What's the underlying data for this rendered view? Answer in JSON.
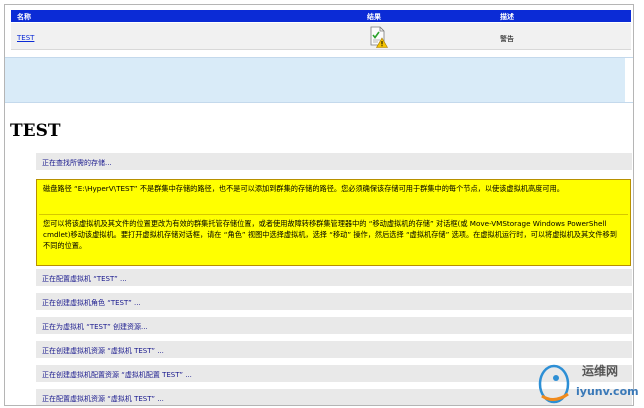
{
  "results_table": {
    "headers": {
      "name": "名称",
      "result": "结果",
      "description": "描述"
    },
    "row": {
      "name": "TEST",
      "result_icon": "warning-doc-icon",
      "description": "警告"
    }
  },
  "section_title": "TEST",
  "steps_before": [
    "正在查找所需的存储..."
  ],
  "warning": {
    "paragraph1": "磁盘路径 “E:\\HyperV\\TEST” 不是群集中存储的路径，也不是可以添加到群集的存储的路径。您必须确保该存储可用于群集中的每个节点，以使该虚拟机高度可用。",
    "paragraph2": "您可以将该虚拟机及其文件的位置更改为有效的群集托管存储位置，或者使用故障转移群集管理器中的 “移动虚拟机的存储” 对话框(或 Move-VMStorage Windows PowerShell cmdlet)移动该虚拟机。要打开虚拟机存储对话框，请在 “角色” 视图中选择虚拟机，选择 “移动” 操作，然后选择 “虚拟机存储” 选项。在虚拟机运行时，可以将虚拟机及其文件移到不同的位置。"
  },
  "steps_after": [
    "正在配置虚拟机 “TEST” ...",
    "正在创建虚拟机角色 “TEST” ...",
    "正在为虚拟机 “TEST” 创建资源...",
    "正在创建虚拟机资源 “虚拟机 TEST” ...",
    "正在创建虚拟机配置资源 “虚拟机配置 TEST” ...",
    "正在配置虚拟机资源 “虚拟机 TEST” ..."
  ],
  "watermark": {
    "brand": "运维网",
    "url": "iyunv.com"
  },
  "colors": {
    "header_blue": "#0b2bd6",
    "warning_yellow": "#ffff00",
    "band_blue": "#d9ebf8"
  }
}
